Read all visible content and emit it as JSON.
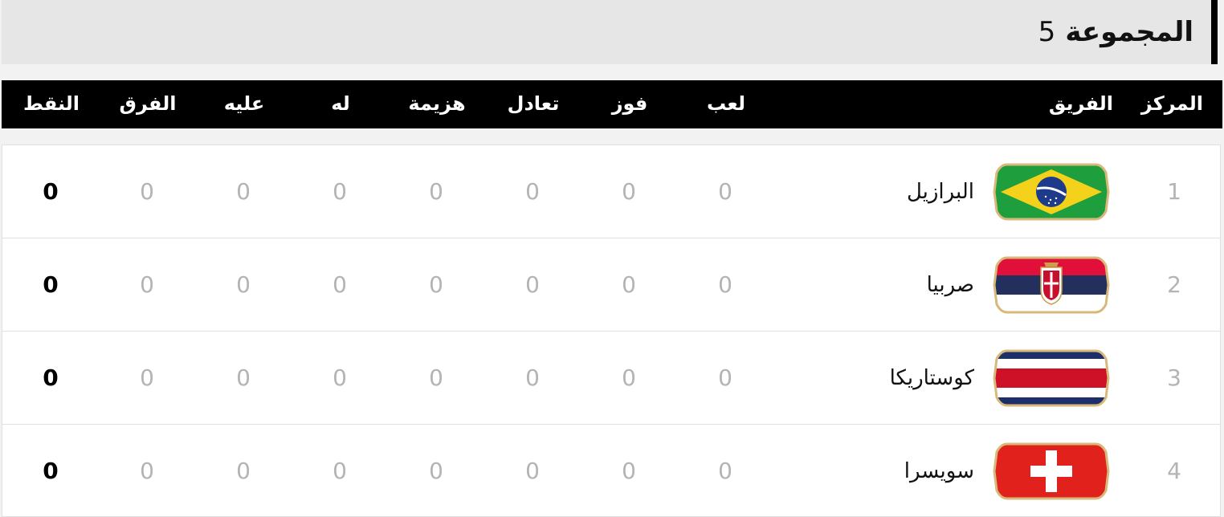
{
  "group": {
    "word": "المجموعة",
    "number": "5"
  },
  "columns": {
    "position": "المركز",
    "team": "الفريق",
    "played": "لعب",
    "won": "فوز",
    "drawn": "تعادل",
    "lost": "هزيمة",
    "goals_for": "له",
    "goals_against": "عليه",
    "goal_diff": "الفرق",
    "points": "النقط"
  },
  "rows": [
    {
      "position": "1",
      "team": "البرازيل",
      "flag_icon": "brazil-flag-icon",
      "played": "0",
      "won": "0",
      "drawn": "0",
      "lost": "0",
      "goals_for": "0",
      "goals_against": "0",
      "goal_diff": "0",
      "points": "0"
    },
    {
      "position": "2",
      "team": "صربيا",
      "flag_icon": "serbia-flag-icon",
      "played": "0",
      "won": "0",
      "drawn": "0",
      "lost": "0",
      "goals_for": "0",
      "goals_against": "0",
      "goal_diff": "0",
      "points": "0"
    },
    {
      "position": "3",
      "team": "كوستاريكا",
      "flag_icon": "costa-rica-flag-icon",
      "played": "0",
      "won": "0",
      "drawn": "0",
      "lost": "0",
      "goals_for": "0",
      "goals_against": "0",
      "goal_diff": "0",
      "points": "0"
    },
    {
      "position": "4",
      "team": "سويسرا",
      "flag_icon": "switzerland-flag-icon",
      "played": "0",
      "won": "0",
      "drawn": "0",
      "lost": "0",
      "goals_for": "0",
      "goals_against": "0",
      "goal_diff": "0",
      "points": "0"
    }
  ],
  "colors": {
    "header_bg": "#000000",
    "title_bar_bg": "#e6e6e6",
    "muted_text": "#b4b4b4",
    "flag_border": "#d9b97a"
  }
}
